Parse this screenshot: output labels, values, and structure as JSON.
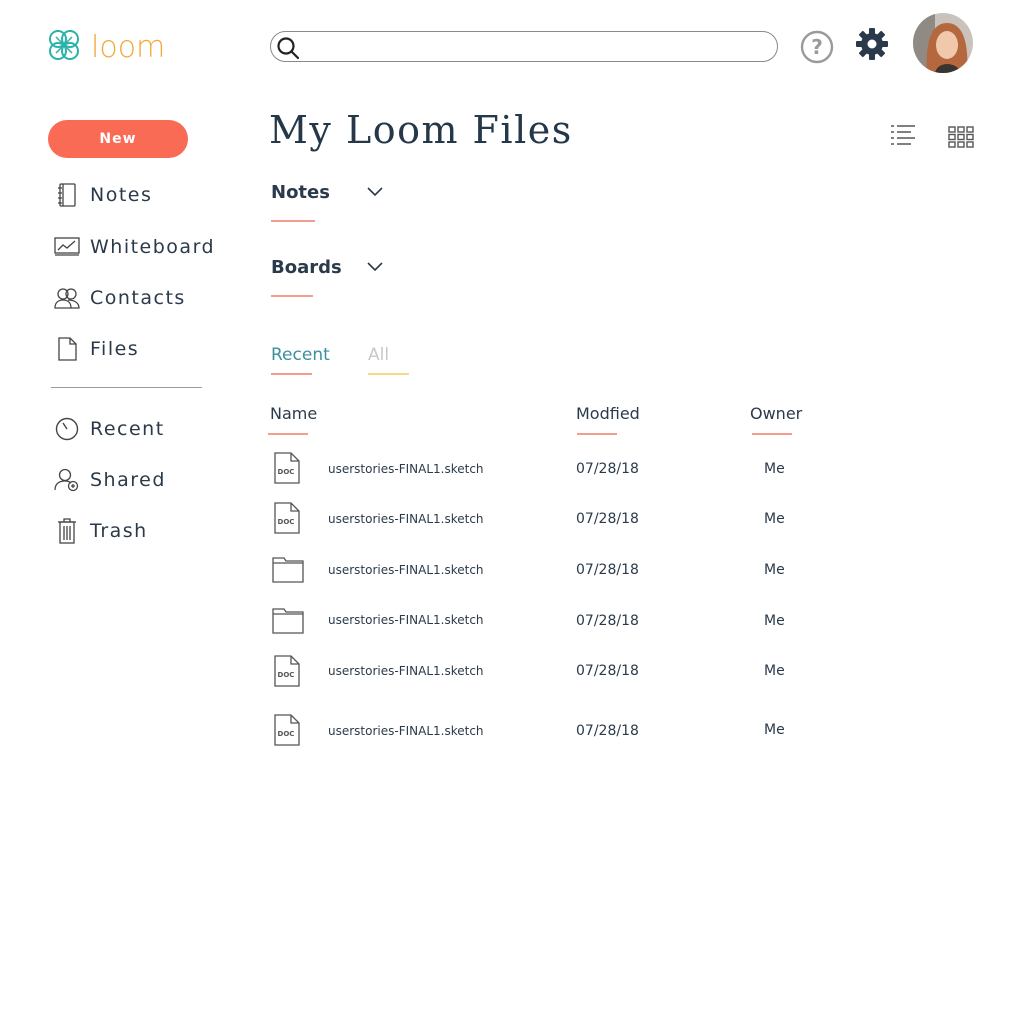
{
  "brand": {
    "name": "loom",
    "logo_color": "#2bb3a8",
    "text_color": "#f2a93b"
  },
  "search": {
    "value": "",
    "placeholder": ""
  },
  "header_icons": [
    "search-icon",
    "help-icon",
    "gear-icon",
    "avatar"
  ],
  "sidebar": {
    "new_label": "New",
    "new_color": "#fa6b55",
    "items": [
      {
        "label": "Notes",
        "icon": "notebook-icon"
      },
      {
        "label": "Whiteboard",
        "icon": "whiteboard-icon"
      },
      {
        "label": "Contacts",
        "icon": "contacts-icon"
      },
      {
        "label": "Files",
        "icon": "file-icon"
      },
      {
        "label": "Recent",
        "icon": "clock-icon"
      },
      {
        "label": "Shared",
        "icon": "shared-user-icon"
      },
      {
        "label": "Trash",
        "icon": "trash-icon"
      }
    ]
  },
  "main": {
    "title": "My Loom Files",
    "sections": [
      {
        "label": "Notes"
      },
      {
        "label": "Boards"
      }
    ],
    "tabs": [
      {
        "label": "Recent",
        "active": true,
        "color": "#3d8e9e"
      },
      {
        "label": "All",
        "active": false,
        "color": "#c8c8c8"
      }
    ],
    "columns": {
      "name": "Name",
      "modified": "Modfied",
      "owner": "Owner"
    },
    "files": [
      {
        "name": "userstories-FINAL1.sketch",
        "modified": "07/28/18",
        "owner": "Me",
        "type": "doc"
      },
      {
        "name": "userstories-FINAL1.sketch",
        "modified": "07/28/18",
        "owner": "Me",
        "type": "doc"
      },
      {
        "name": "userstories-FINAL1.sketch",
        "modified": "07/28/18",
        "owner": "Me",
        "type": "folder"
      },
      {
        "name": "userstories-FINAL1.sketch",
        "modified": "07/28/18",
        "owner": "Me",
        "type": "folder"
      },
      {
        "name": "userstories-FINAL1.sketch",
        "modified": "07/28/18",
        "owner": "Me",
        "type": "doc"
      },
      {
        "name": "userstories-FINAL1.sketch",
        "modified": "07/28/18",
        "owner": "Me",
        "type": "doc"
      }
    ],
    "doc_icon_text": "DOC"
  }
}
